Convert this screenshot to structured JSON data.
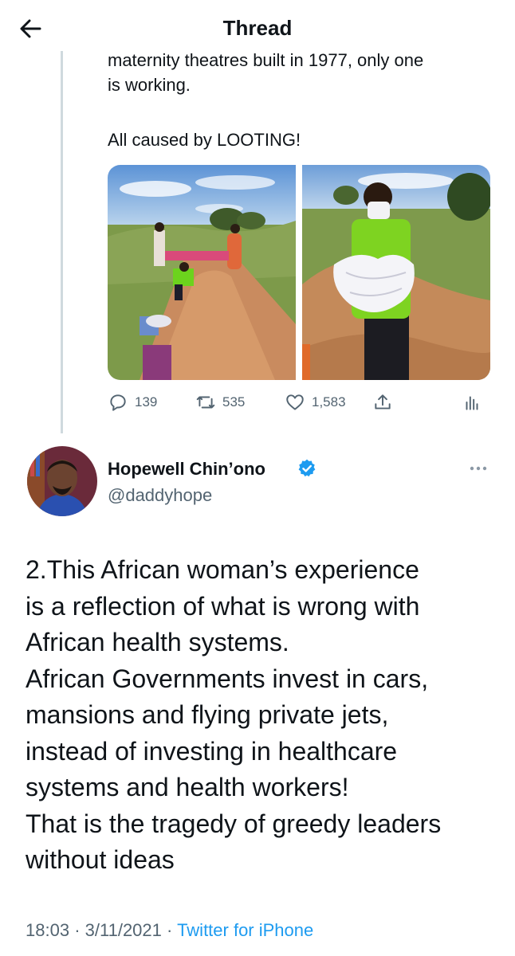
{
  "header": {
    "title": "Thread"
  },
  "previous_tweet": {
    "text_line1": "maternity theatres built in 1977, only one",
    "text_line2": "is working.",
    "text_line3": "All caused by LOOTING!",
    "stats": {
      "replies": "139",
      "retweets": "535",
      "likes": "1,583"
    }
  },
  "main_tweet": {
    "author": {
      "name": "Hopewell Chin’ono",
      "handle": "@daddyhope",
      "verified": true
    },
    "lines": [
      "2.This African woman’s experience",
      "is a reflection of what is wrong with",
      "African health systems.",
      "African Governments invest in cars,",
      "mansions and flying private jets,",
      "instead of investing in healthcare",
      "systems and health workers!",
      "That is the tragedy of greedy leaders",
      "without ideas"
    ],
    "time": "18:03",
    "date": "3/11/2021",
    "separator": "·",
    "source": "Twitter for iPhone"
  },
  "colors": {
    "accent": "#1d9bf0",
    "muted": "#536471",
    "text": "#0f1419",
    "thread_line": "#cfd9de"
  }
}
